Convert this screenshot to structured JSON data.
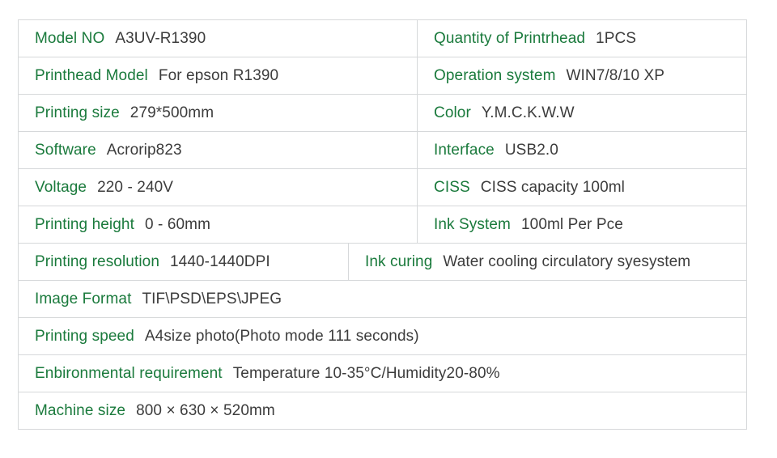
{
  "table": {
    "rows": [
      {
        "layout": "two-col",
        "cells": [
          {
            "label": "Model NO",
            "value": "A3UV-R1390"
          },
          {
            "label": "Quantity of Printrhead",
            "value": "1PCS"
          }
        ]
      },
      {
        "layout": "two-col",
        "cells": [
          {
            "label": "Printhead Model",
            "value": "For epson R1390"
          },
          {
            "label": "Operation system",
            "value": "WIN7/8/10  XP"
          }
        ]
      },
      {
        "layout": "two-col",
        "cells": [
          {
            "label": "Printing size",
            "value": "279*500mm"
          },
          {
            "label": "Color",
            "value": "Y.M.C.K.W.W"
          }
        ]
      },
      {
        "layout": "two-col",
        "cells": [
          {
            "label": "Software",
            "value": "Acrorip823"
          },
          {
            "label": "Interface",
            "value": "USB2.0"
          }
        ]
      },
      {
        "layout": "two-col",
        "cells": [
          {
            "label": "Voltage",
            "value": "220 - 240V"
          },
          {
            "label": "CISS",
            "value": "CISS capacity 100ml"
          }
        ]
      },
      {
        "layout": "two-col",
        "cells": [
          {
            "label": "Printing height",
            "value": "0 - 60mm"
          },
          {
            "label": "Ink System",
            "value": "100ml Per Pce"
          }
        ]
      },
      {
        "layout": "two-col-narrow",
        "cells": [
          {
            "label": "Printing resolution",
            "value": "1440-1440DPI"
          },
          {
            "label": "Ink curing",
            "value": "Water cooling circulatory syesystem"
          }
        ]
      },
      {
        "layout": "full",
        "cells": [
          {
            "label": "Image Format",
            "value": "TIF\\PSD\\EPS\\JPEG"
          }
        ]
      },
      {
        "layout": "full",
        "cells": [
          {
            "label": "Printing speed",
            "value": "A4size photo(Photo mode 111 seconds)"
          }
        ]
      },
      {
        "layout": "full",
        "cells": [
          {
            "label": "Enbironmental requirement",
            "value": "Temperature 10-35°C/Humidity20-80%"
          }
        ]
      },
      {
        "layout": "full",
        "cells": [
          {
            "label": "Machine size",
            "value": "800 × 630 × 520mm"
          }
        ]
      }
    ]
  },
  "colors": {
    "label": "#1a7a3c",
    "value": "#3c3c3c",
    "border": "#d6d8da",
    "background": "#ffffff"
  }
}
